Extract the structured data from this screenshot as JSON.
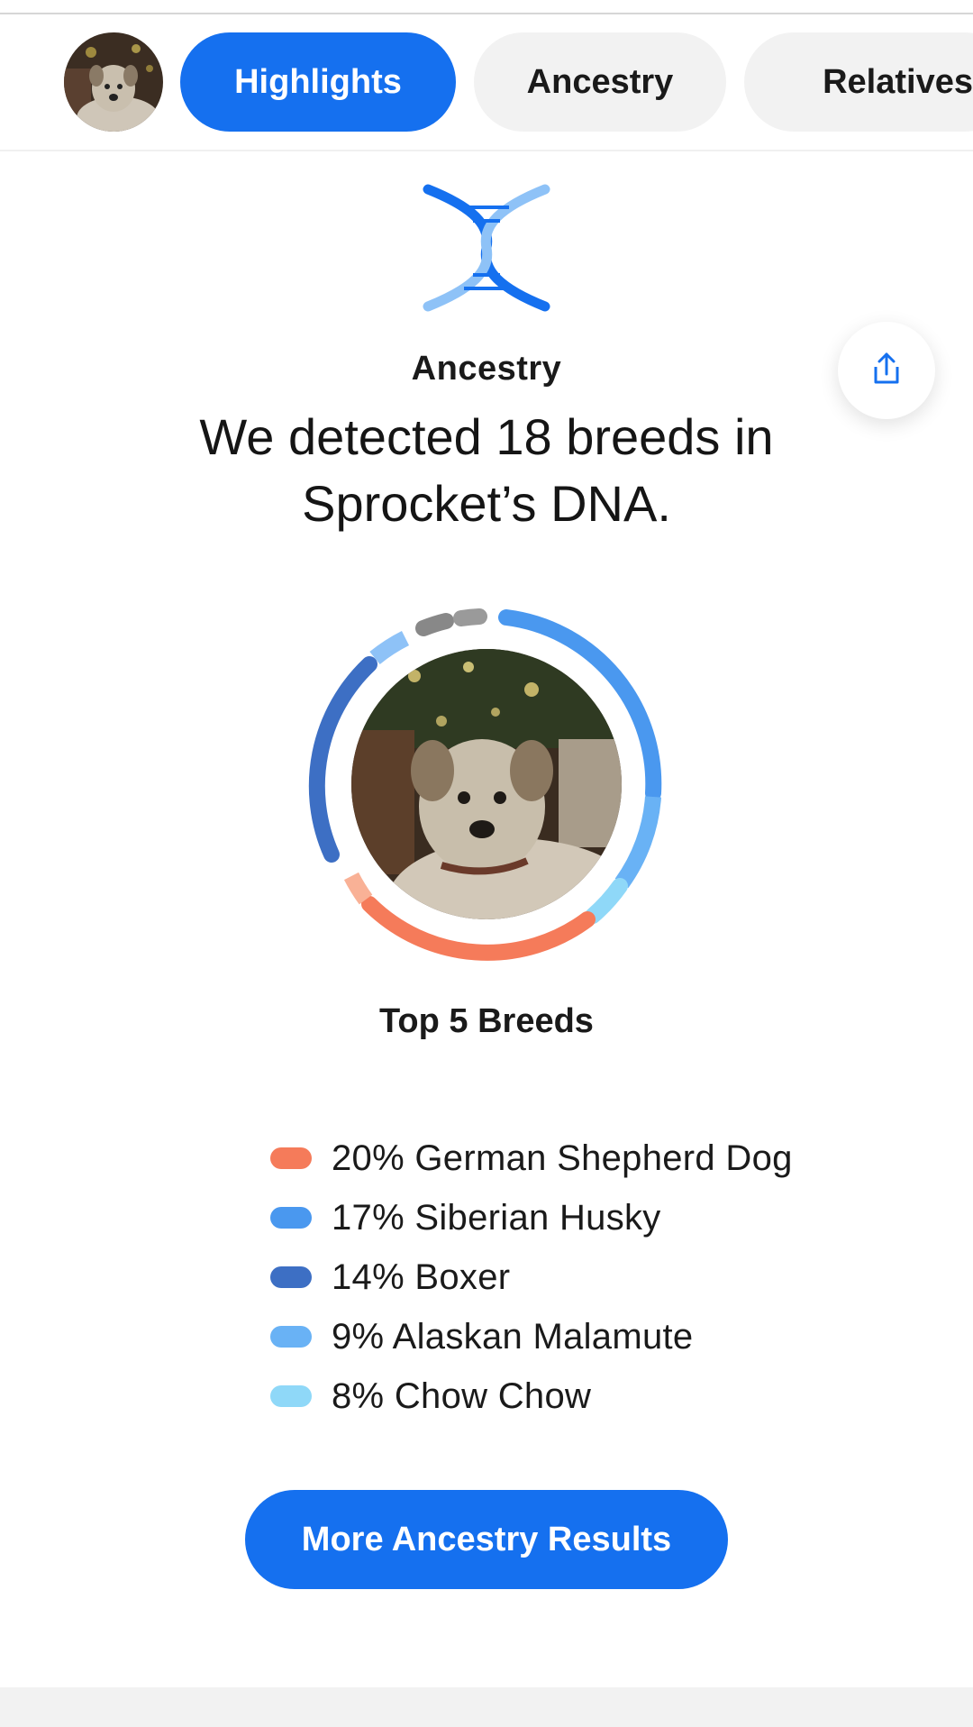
{
  "tabs": [
    {
      "label": "Highlights",
      "active": true
    },
    {
      "label": "Ancestry",
      "active": false
    },
    {
      "label": "Relatives",
      "active": false
    }
  ],
  "section_label": "Ancestry",
  "headline_line1": "We detected 18 breeds in",
  "headline_line2": "Sprocket’s DNA.",
  "top_breeds_title": "Top 5 Breeds",
  "breeds": [
    {
      "percent": "20%",
      "name": "German Shepherd Dog",
      "color": "#f57b5a"
    },
    {
      "percent": "17%",
      "name": "Siberian Husky",
      "color": "#4a98ef"
    },
    {
      "percent": "14%",
      "name": "Boxer",
      "color": "#3d6fc4"
    },
    {
      "percent": "9%",
      "name": "Alaskan Malamute",
      "color": "#69b2f5"
    },
    {
      "percent": "8%",
      "name": "Chow Chow",
      "color": "#8fd8f8"
    }
  ],
  "cta_label": "More Ancestry Results",
  "icons": {
    "dna": "dna-icon",
    "share": "share-icon"
  },
  "accent_color": "#1570ef"
}
